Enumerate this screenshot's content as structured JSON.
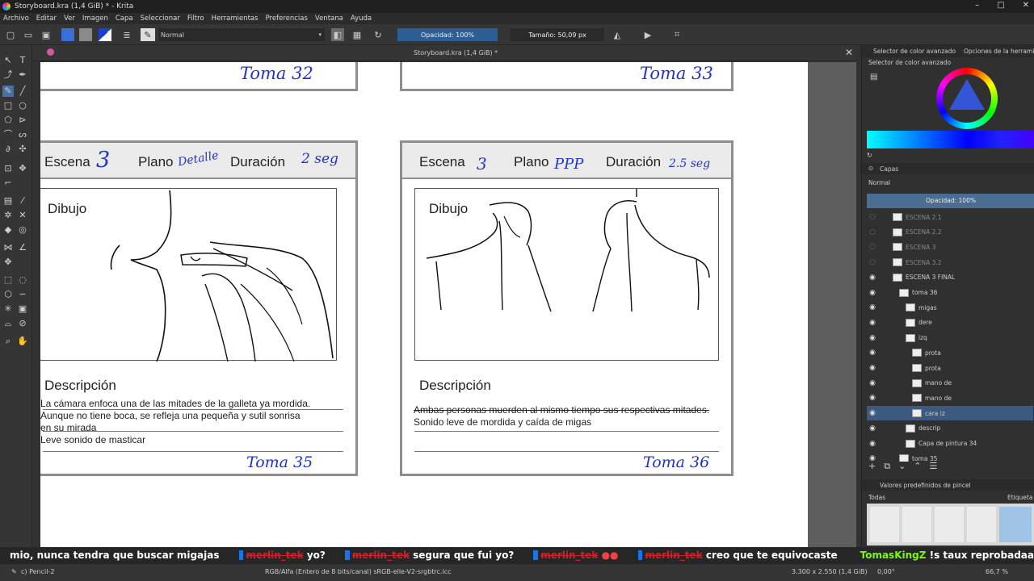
{
  "window": {
    "title": "Storyboard.kra (1,4 GiB) * - Krita"
  },
  "menu": [
    "Archivo",
    "Editar",
    "Ver",
    "Imagen",
    "Capa",
    "Seleccionar",
    "Filtro",
    "Herramientas",
    "Preferencias",
    "Ventana",
    "Ayuda"
  ],
  "toolbar": {
    "blend_mode": "Normal",
    "opacity": "Opacidad: 100%",
    "size": "Tamaño: 50,09 px"
  },
  "document_tab": "Storyboard.kra (1,4 GiB) *",
  "storyboard": {
    "toma_32": "Toma 32",
    "toma_33": "Toma 33",
    "panel_left": {
      "escena_label": "Escena",
      "escena_value": "3",
      "plano_label": "Plano",
      "plano_value": "Detalle",
      "duracion_label": "Duración",
      "duracion_value": "2 seg",
      "dibujo_label": "Dibujo",
      "descripcion_label": "Descripción",
      "desc_lines": [
        "La cámara enfoca una de las mitades de la galleta ya mordida.",
        "Aunque no tiene boca, se refleja una pequeña y sutil sonrisa",
        "en su mirada",
        "Leve sonido de masticar"
      ],
      "toma": "Toma 35"
    },
    "panel_right": {
      "escena_label": "Escena",
      "escena_value": "3",
      "plano_label": "Plano",
      "plano_value": "PPP",
      "duracion_label": "Duración",
      "duracion_value": "2.5 seg",
      "dibujo_label": "Dibujo",
      "descripcion_label": "Descripción",
      "desc_lines": [
        "Ambas personas muerden al mismo tiempo sus respectivas mitades.",
        "Sonido leve de mordida y caída de migas"
      ],
      "toma": "Toma 36"
    }
  },
  "color_panel": {
    "tab1": "Selector de color avanzado",
    "tab2": "Opciones de la herramienta",
    "title": "Selector de color avanzado"
  },
  "layers_panel": {
    "title": "Capas",
    "blend": "Normal",
    "opacity": "Opacidad:  100%",
    "layers": [
      {
        "name": "ESCENA 2.1",
        "visible": false,
        "indent": 0
      },
      {
        "name": "ESCENA 2.2",
        "visible": false,
        "indent": 0
      },
      {
        "name": "ESCENA 3",
        "visible": false,
        "indent": 0
      },
      {
        "name": "ESCENA 3.2",
        "visible": false,
        "indent": 0
      },
      {
        "name": "ESCENA 3 FINAL",
        "visible": true,
        "indent": 0
      },
      {
        "name": "toma 36",
        "visible": true,
        "indent": 1
      },
      {
        "name": "migas",
        "visible": true,
        "indent": 2
      },
      {
        "name": "dere",
        "visible": true,
        "indent": 2
      },
      {
        "name": "izq",
        "visible": true,
        "indent": 2
      },
      {
        "name": "prota",
        "visible": true,
        "indent": 3
      },
      {
        "name": "prota",
        "visible": true,
        "indent": 3
      },
      {
        "name": "mano de",
        "visible": true,
        "indent": 3
      },
      {
        "name": "mano de",
        "visible": true,
        "indent": 3
      },
      {
        "name": "cara iz",
        "visible": true,
        "indent": 3,
        "selected": true
      },
      {
        "name": "descrip",
        "visible": true,
        "indent": 2
      },
      {
        "name": "Capa de pintura 34",
        "visible": true,
        "indent": 2
      },
      {
        "name": "toma 35",
        "visible": true,
        "indent": 1
      }
    ]
  },
  "brush_presets": {
    "title": "Valores predefinidos de pincel",
    "filter": "Todas",
    "tag": "Etiqueta"
  },
  "chat": {
    "text0": "mio, nunca tendra que buscar migajas",
    "user1": "merlin_tek",
    "msg1": "yo?",
    "user2": "merlin_tek",
    "msg2": "segura que fui yo?",
    "user3": "merlin_tek",
    "user4": "merlin_tek",
    "msg4": "creo que te equivocaste",
    "user5": "TomasKingZ",
    "msg5": "!s taux reprobadaa"
  },
  "status": {
    "brush": "c) Pencil-2",
    "color": "RGB/Alfa (Entero de 8 bits/canal)  sRGB-elle-V2-srgbtrc.icc",
    "size": "3.300 x 2.550 (1,4 GiB)",
    "rotation": "0,00°",
    "zoom": "66,7 %"
  }
}
